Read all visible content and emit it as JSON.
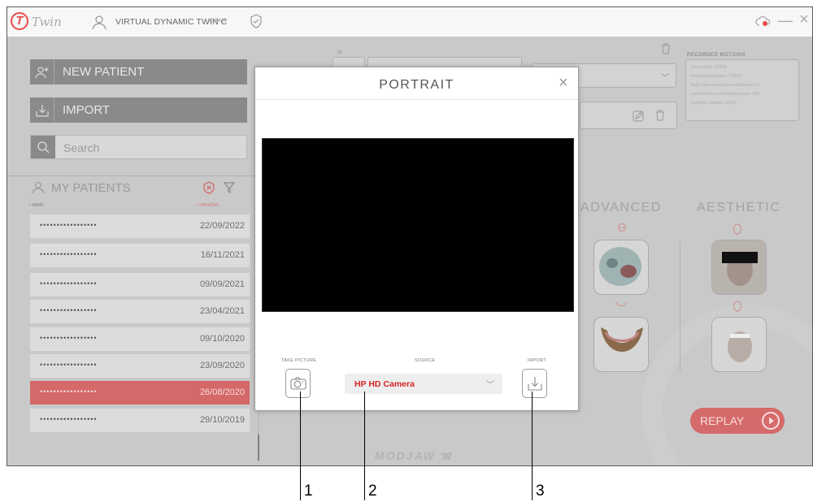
{
  "titlebar": {
    "logo_letter": "T",
    "logo_word": "Twin",
    "device_name": "VIRTUAL DYNAMIC TWIN C",
    "device_code": "CV0448",
    "icons": [
      "user-icon",
      "shield-check-icon",
      "cloud-sync-icon",
      "minimize-icon",
      "close-icon"
    ],
    "minimize": "—",
    "close": "×"
  },
  "sidebar": {
    "new_patient": "NEW PATIENT",
    "import": "IMPORT",
    "search_placeholder": "Search",
    "my_patients": "MY PATIENTS",
    "col_name": "NAME",
    "col_updated": "UPDATED",
    "patients": [
      {
        "name": "•••••••••••••••••",
        "date": "22/09/2022"
      },
      {
        "name": "•••••••••••••••••",
        "date": "16/11/2021"
      },
      {
        "name": "•••••••••••••••••",
        "date": "09/09/2021"
      },
      {
        "name": "•••••••••••••••••",
        "date": "23/04/2021"
      },
      {
        "name": "•••••••••••••••••",
        "date": "09/10/2020"
      },
      {
        "name": "•••••••••••••••••",
        "date": "23/09/2020"
      },
      {
        "name": "•••••••••••••••••",
        "date": "26/08/2020",
        "selected": true
      },
      {
        "name": "•••••••••••••••••",
        "date": "29/10/2019"
      }
    ]
  },
  "main": {
    "id_label": "ID",
    "recorded_motions_title": "RECORDED MOTIONS",
    "recorded_motions": [
      "Open close 16948",
      "Protrusion/recision 16603",
      "Right laterotrusion/mediotrusion 16",
      "Left laterotrusion/mediotrusion 166",
      "Condyle rotation 16603"
    ],
    "advanced_title": "ADVANCED",
    "aesthetic_title": "AESTHETIC",
    "replay_label": "REPLAY",
    "brand": "MODJAW",
    "brand_mark": "'///"
  },
  "modal": {
    "title": "PORTRAIT",
    "close": "×",
    "take_picture_label": "TAKE PICTURE",
    "source_label": "SOURCE",
    "import_label": "IMPORT",
    "source_value": "HP HD Camera",
    "accent_color": "#d62424"
  },
  "callouts": [
    "1",
    "2",
    "3"
  ]
}
